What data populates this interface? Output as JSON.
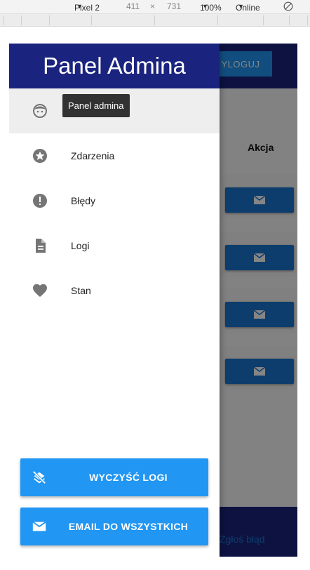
{
  "devtools": {
    "device": "Pixel 2",
    "width": "411",
    "times": "×",
    "height": "731",
    "zoom": "100%",
    "network": "Online"
  },
  "app": {
    "logout_label": "YLOGUJ",
    "column_header": "Akcja",
    "report_link": "Zgłoś błąd"
  },
  "drawer": {
    "title": "Panel Admina",
    "tooltip": "Panel admina",
    "items": [
      {
        "label": "",
        "icon": "face-icon"
      },
      {
        "label": "Zdarzenia",
        "icon": "star-icon"
      },
      {
        "label": "Błędy",
        "icon": "error-icon"
      },
      {
        "label": "Logi",
        "icon": "document-icon"
      },
      {
        "label": "Stan",
        "icon": "heart-icon"
      }
    ],
    "clear_logs_label": "WYCZYŚĆ LOGI",
    "email_all_label": "EMAIL DO WSZYSTKICH"
  },
  "colors": {
    "primary": "#1a237e",
    "accent": "#2196f3"
  }
}
